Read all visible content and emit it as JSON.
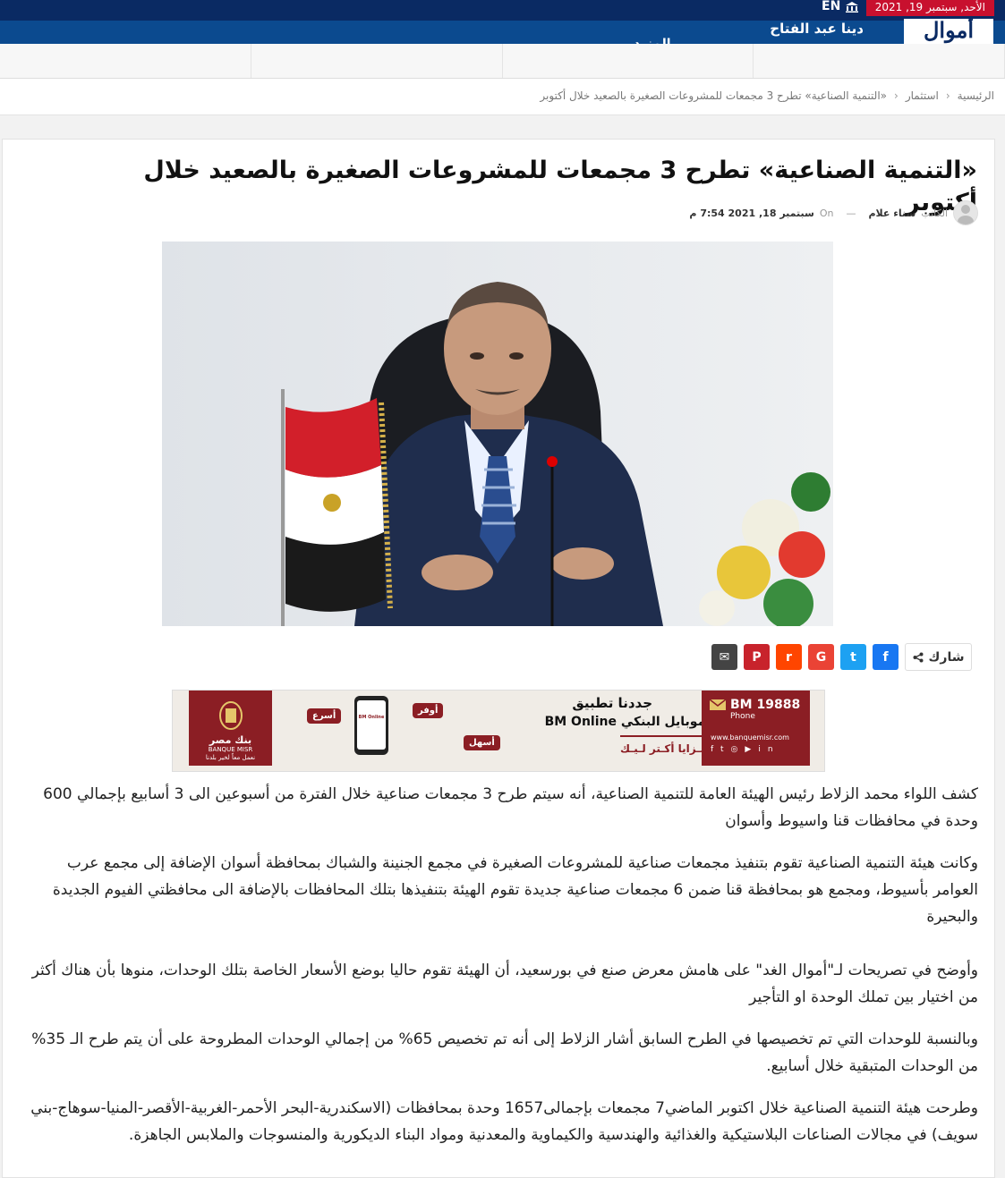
{
  "topbar": {
    "date": "الأحد, سبتمبر 19, 2021",
    "lang": "EN"
  },
  "nav": {
    "logo_text": "أموال",
    "author_link": "دينا عبد الفتاح",
    "more_label": "المزيد"
  },
  "breadcrumb": {
    "home": "الرئيسية",
    "section": "استثمار",
    "current": "«التنمية الصناعية» تطرح 3 مجمعات للمشروعات الصغيرة بالصعيد خلال أكتوبر"
  },
  "article": {
    "title": "«التنمية الصناعية» تطرح 3 مجمعات للمشروعات الصغيرة بالصعيد خلال أكتوبر",
    "meta": {
      "writer_label": "الكاتب",
      "writer_name": "سناء علام",
      "dash": "—",
      "on_label": "On",
      "date": "سبتمبر 18, 2021 7:54 م"
    },
    "share_label": "شارك",
    "paragraphs": [
      "كشف اللواء محمد الزلاط رئيس الهيئة العامة للتنمية الصناعية، أنه سيتم طرح 3 مجمعات صناعية خلال الفترة من أسبوعين الى 3 أسابيع بإجمالي 600 وحدة في محافظات قنا واسيوط وأسوان",
      "وكانت هيئة التنمية الصناعية تقوم بتنفيذ مجمعات صناعية للمشروعات الصغيرة في مجمع الجنينة والشباك بمحافظة أسوان الإضافة إلى  مجمع عرب العوامر بأسيوط، ومجمع هو بمحافظة قنا ضمن 6 مجمعات صناعية جديدة تقوم الهيئة بتنفيذها بتلك المحافظات بالإضافة الى محافظتي الفيوم الجديدة والبحيرة",
      "وأوضح في تصريحات لـ\"أموال الغد\" على هامش معرض صنع في بورسعيد، أن الهيئة تقوم حاليا بوضع الأسعار الخاصة بتلك الوحدات، منوها بأن هناك أكثر من اختيار بين تملك الوحدة او التأجير",
      "وبالنسبة للوحدات التي تم تخصيصها في الطرح السابق  أشار الزلاط إلى أنه تم تخصيص 65% من إجمالي الوحدات المطروحة على أن يتم طرح الـ 35% من الوحدات المتبقية خلال أسابيع.",
      "وطرحت هيئة التنمية الصناعية خلال اكتوبر الماضي7 مجمعات بإجمالى1657 وحدة بمحافظات (الاسكندرية-البحر الأحمر-الغربية-الأقصر-المنيا-سوهاج-بني سويف) في مجالات الصناعات البلاستيكية والغذائية والهندسية والكيماوية والمعدنية ومواد البناء الديكورية والمنسوجات والملابس الجاهزة."
    ]
  },
  "share_buttons": [
    {
      "name": "facebook-share-button",
      "glyph": "f",
      "color": "#1877f2"
    },
    {
      "name": "twitter-share-button",
      "glyph": "t",
      "color": "#1da1f2"
    },
    {
      "name": "google-share-button",
      "glyph": "G",
      "color": "#ea4335"
    },
    {
      "name": "reddit-share-button",
      "glyph": "r",
      "color": "#ff4500"
    },
    {
      "name": "pinterest-share-button",
      "glyph": "P",
      "color": "#c8232c"
    },
    {
      "name": "email-share-button",
      "glyph": "✉",
      "color": "#444444"
    }
  ],
  "ad": {
    "bank_name_ar": "بنك مصر",
    "bank_name_en": "BANQUE MISR",
    "bank_slogan": "نعمل معاً لخير بلدنا",
    "headline": "جددنا تطبيق",
    "subheadline": "الموبايل البنكي BM Online",
    "tagline": "بـمـزايا أكـتر لـيـك",
    "badge_1": "أوفر",
    "badge_2": "أسرع",
    "badge_3": "أسهل",
    "hotline": "BM 19888",
    "hotline_sub": "Phone",
    "website": "www.banquemisr.com",
    "app_label": "BM Online"
  },
  "colors": {
    "topbar": "#0a2a63",
    "nav": "#0b4a8f",
    "accent_red": "#c8102e"
  }
}
